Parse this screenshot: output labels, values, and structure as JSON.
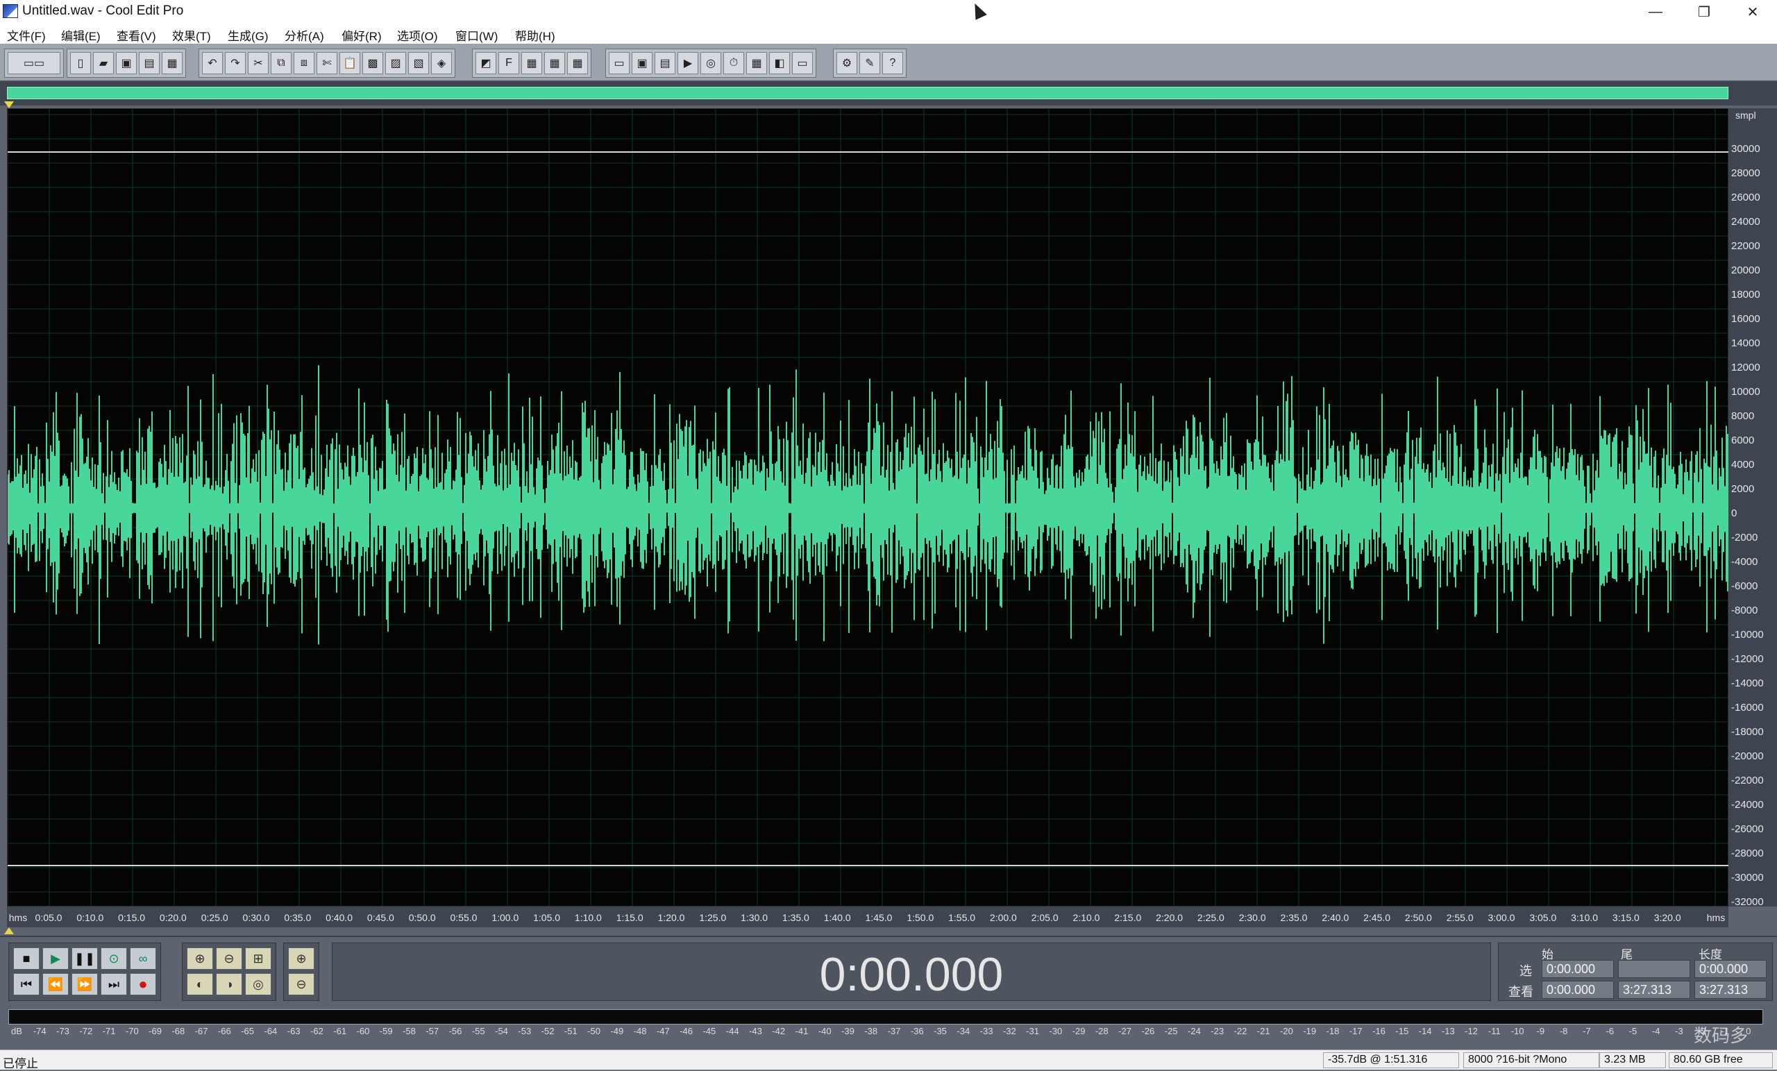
{
  "window": {
    "title": "Untitled.wav - Cool Edit Pro",
    "controls": [
      "—",
      "❐",
      "✕"
    ]
  },
  "menu": [
    "文件(F)",
    "编辑(E)",
    "查看(V)",
    "效果(T)",
    "生成(G)",
    "分析(A)",
    "偏好(R)",
    "选项(O)",
    "窗口(W)",
    "帮助(H)"
  ],
  "waveform": {
    "unit": "smpl",
    "y_ticks": [
      "30000",
      "28000",
      "26000",
      "24000",
      "22000",
      "20000",
      "18000",
      "16000",
      "14000",
      "12000",
      "10000",
      "8000",
      "6000",
      "4000",
      "2000",
      "0",
      "-2000",
      "-4000",
      "-6000",
      "-8000",
      "-10000",
      "-12000",
      "-14000",
      "-16000",
      "-18000",
      "-20000",
      "-22000",
      "-24000",
      "-26000",
      "-28000",
      "-30000",
      "-32000"
    ],
    "x_unit": "hms",
    "x_ticks": [
      "0:05.0",
      "0:10.0",
      "0:15.0",
      "0:20.0",
      "0:25.0",
      "0:30.0",
      "0:35.0",
      "0:40.0",
      "0:45.0",
      "0:50.0",
      "0:55.0",
      "1:00.0",
      "1:05.0",
      "1:10.0",
      "1:15.0",
      "1:20.0",
      "1:25.0",
      "1:30.0",
      "1:35.0",
      "1:40.0",
      "1:45.0",
      "1:50.0",
      "1:55.0",
      "2:00.0",
      "2:05.0",
      "2:10.0",
      "2:15.0",
      "2:20.0",
      "2:25.0",
      "2:30.0",
      "2:35.0",
      "2:40.0",
      "2:45.0",
      "2:50.0",
      "2:55.0",
      "3:00.0",
      "3:05.0",
      "3:10.0",
      "3:15.0",
      "3:20.0"
    ],
    "wave_color": "#48d69a"
  },
  "transport": {
    "time": "0:00.000",
    "headers": {
      "begin": "始",
      "end": "尾",
      "length": "长度"
    },
    "rows": [
      {
        "label": "选",
        "begin": "0:00.000",
        "end": "",
        "length": "0:00.000"
      },
      {
        "label": "查看",
        "begin": "0:00.000",
        "end": "3:27.313",
        "length": "3:27.313"
      }
    ]
  },
  "meter": {
    "ticks": [
      "dB",
      "-74",
      "-73",
      "-72",
      "-71",
      "-70",
      "-69",
      "-68",
      "-67",
      "-66",
      "-65",
      "-64",
      "-63",
      "-62",
      "-61",
      "-60",
      "-59",
      "-58",
      "-57",
      "-56",
      "-55",
      "-54",
      "-53",
      "-52",
      "-51",
      "-50",
      "-49",
      "-48",
      "-47",
      "-46",
      "-45",
      "-44",
      "-43",
      "-42",
      "-41",
      "-40",
      "-39",
      "-38",
      "-37",
      "-36",
      "-35",
      "-34",
      "-33",
      "-32",
      "-31",
      "-30",
      "-29",
      "-28",
      "-27",
      "-26",
      "-25",
      "-24",
      "-23",
      "-22",
      "-21",
      "-20",
      "-19",
      "-18",
      "-17",
      "-16",
      "-15",
      "-14",
      "-13",
      "-12",
      "-11",
      "-10",
      "-9",
      "-8",
      "-7",
      "-6",
      "-5",
      "-4",
      "-3",
      "-2",
      "-1",
      "0"
    ]
  },
  "status": {
    "state": "已停止",
    "level": "-35.7dB @  1:51.316",
    "format": "8000 ?16-bit ?Mono",
    "size": "3.23 MB",
    "free": "80.60 GB free"
  },
  "watermark": "数码多"
}
